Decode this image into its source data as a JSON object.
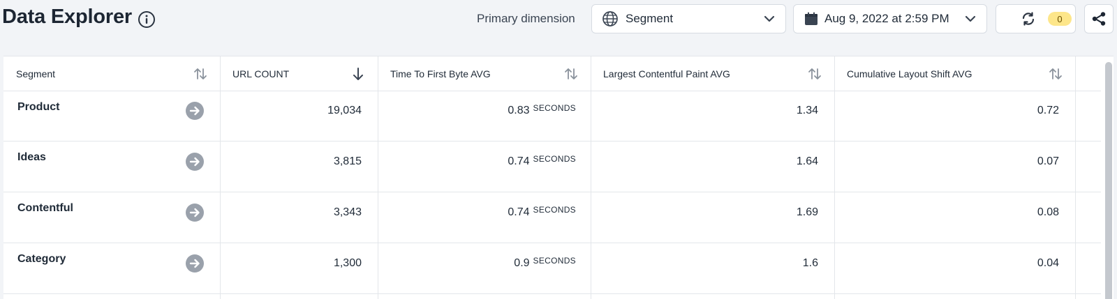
{
  "header": {
    "title": "Data Explorer",
    "primary_dimension_label": "Primary dimension",
    "dimension_value": "Segment",
    "date_value": "Aug 9, 2022 at 2:59 PM",
    "refresh_count": "0"
  },
  "table": {
    "columns": [
      {
        "label": "Segment"
      },
      {
        "label": "URL COUNT"
      },
      {
        "label": "Time To First Byte AVG"
      },
      {
        "label": "Largest Contentful Paint AVG"
      },
      {
        "label": "Cumulative Layout Shift AVG"
      }
    ],
    "rows": [
      {
        "segment": "Product",
        "url_count": "19,034",
        "ttfb": "0.83",
        "ttfb_unit": "SECONDS",
        "lcp": "1.34",
        "cls": "0.72"
      },
      {
        "segment": "Ideas",
        "url_count": "3,815",
        "ttfb": "0.74",
        "ttfb_unit": "SECONDS",
        "lcp": "1.64",
        "cls": "0.07"
      },
      {
        "segment": "Contentful",
        "url_count": "3,343",
        "ttfb": "0.74",
        "ttfb_unit": "SECONDS",
        "lcp": "1.69",
        "cls": "0.08"
      },
      {
        "segment": "Category",
        "url_count": "1,300",
        "ttfb": "0.9",
        "ttfb_unit": "SECONDS",
        "lcp": "1.6",
        "cls": "0.04"
      }
    ]
  },
  "colors": {
    "badge_bg": "#fde68a",
    "go_icon": "#9aa1ab"
  }
}
